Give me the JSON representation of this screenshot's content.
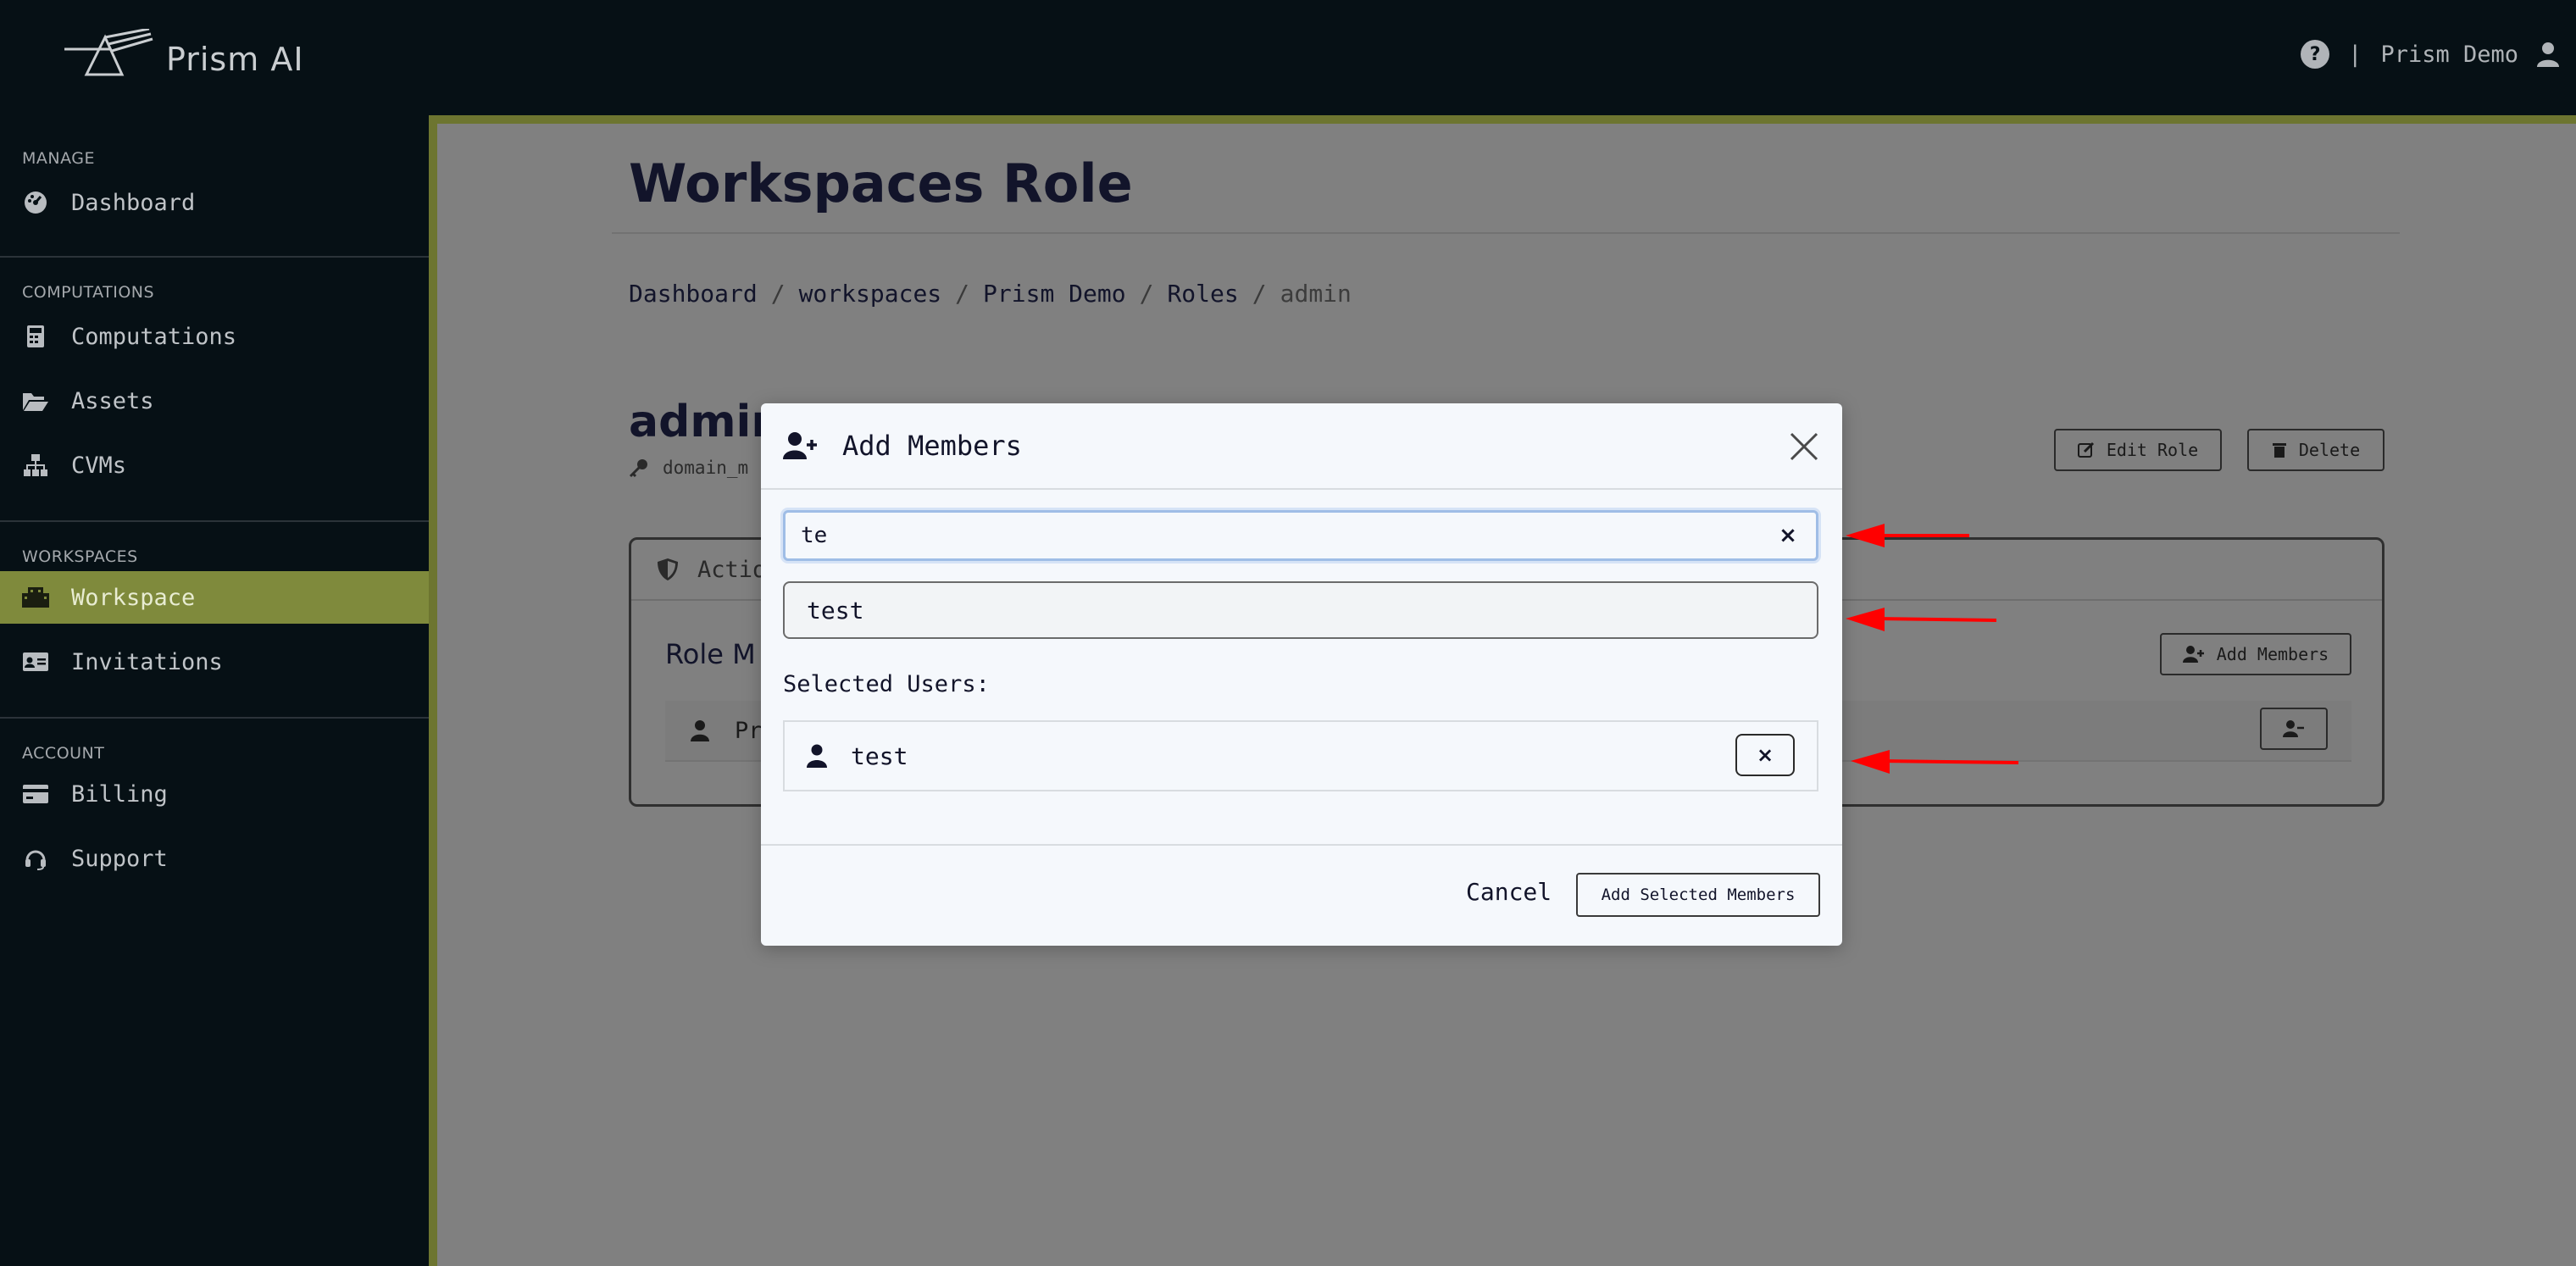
{
  "app": {
    "brand": "Prism AI",
    "help_glyph": "?",
    "separator": "|",
    "user_name": "Prism Demo"
  },
  "sidebar": {
    "sections": [
      {
        "heading": "MANAGE",
        "items": [
          {
            "label": "Dashboard",
            "icon": "gauge-icon"
          }
        ]
      },
      {
        "heading": "COMPUTATIONS",
        "items": [
          {
            "label": "Computations",
            "icon": "calculator-icon"
          },
          {
            "label": "Assets",
            "icon": "folder-open-icon"
          },
          {
            "label": "CVMs",
            "icon": "sitemap-icon"
          }
        ]
      },
      {
        "heading": "WORKSPACES",
        "items": [
          {
            "label": "Workspace",
            "icon": "building-icon",
            "active": true
          },
          {
            "label": "Invitations",
            "icon": "id-card-icon"
          }
        ]
      },
      {
        "heading": "ACCOUNT",
        "items": [
          {
            "label": "Billing",
            "icon": "credit-card-icon"
          },
          {
            "label": "Support",
            "icon": "headset-icon"
          }
        ]
      }
    ]
  },
  "page": {
    "title": "Workspaces Role",
    "breadcrumb": [
      "Dashboard",
      "workspaces",
      "Prism Demo",
      "Roles",
      "admin"
    ],
    "breadcrumb_separator": "/",
    "role_name": "admin",
    "role_sub": "domain_m",
    "edit_role_label": "Edit Role",
    "delete_label": "Delete",
    "card_tab_label": "Actio",
    "card_subtitle": "Role M",
    "add_members_label": "Add Members",
    "member_row_text": "Pri"
  },
  "modal": {
    "title": "Add Members",
    "search_value": "te",
    "clear_glyph": "×",
    "suggestion": "test",
    "selected_label": "Selected Users:",
    "selected_users": [
      "test"
    ],
    "remove_glyph": "×",
    "cancel_label": "Cancel",
    "submit_label": "Add Selected Members"
  },
  "colors": {
    "topbar": "#061015",
    "sidebar": "#061015",
    "accent": "#7f8a3c",
    "overlay": "#808080",
    "modal_bg": "#f5f8fc",
    "annotation_arrow": "#ff0000"
  }
}
